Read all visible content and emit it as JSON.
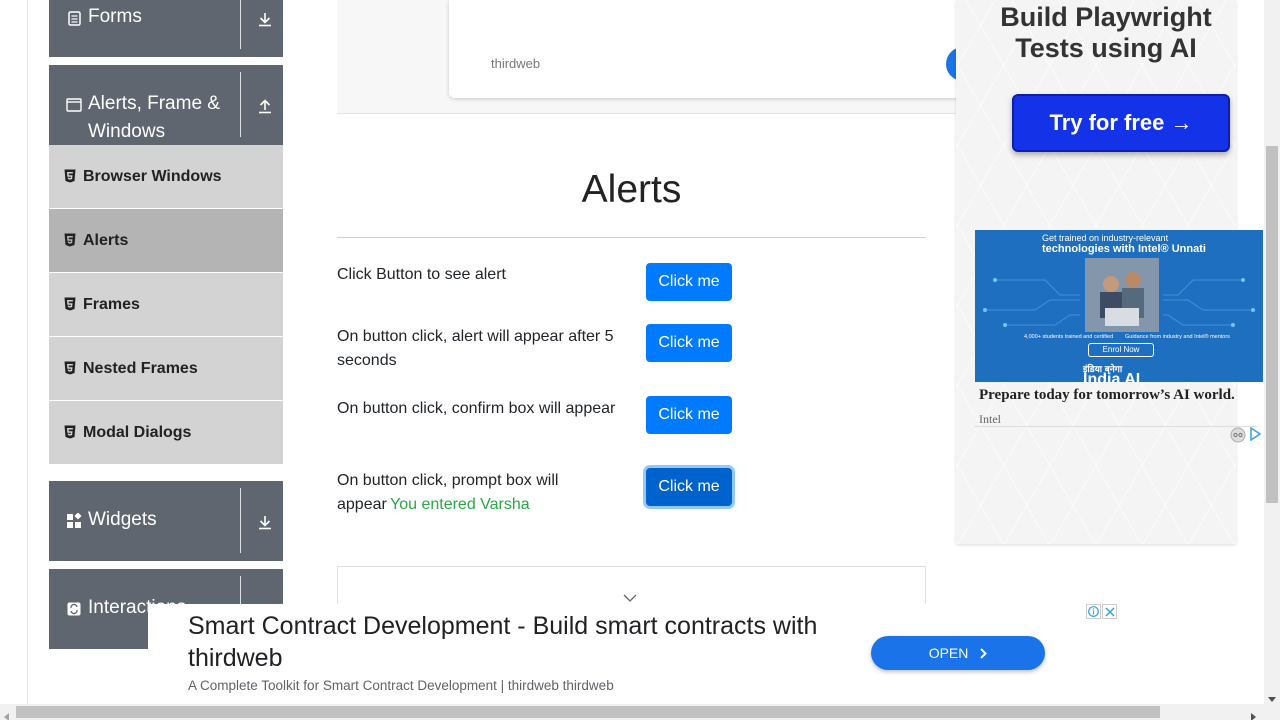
{
  "sidebar": {
    "groups": [
      {
        "label": "Forms",
        "icon": "form-icon",
        "arrow": "download-arrow-icon"
      },
      {
        "label": "Alerts, Frame &",
        "label2": "Windows",
        "icon": "window-icon",
        "arrow": "upload-arrow-icon"
      },
      {
        "label": "Widgets",
        "icon": "widgets-icon",
        "arrow": "download-arrow-icon"
      },
      {
        "label": "Interactions",
        "icon": "interactions-icon"
      }
    ],
    "items": [
      {
        "label": "Browser Windows"
      },
      {
        "label": "Alerts",
        "active": true
      },
      {
        "label": "Frames"
      },
      {
        "label": "Nested Frames"
      },
      {
        "label": "Modal Dialogs"
      }
    ]
  },
  "top_ad": {
    "brand": "thirdweb"
  },
  "main": {
    "title": "Alerts",
    "rows": [
      {
        "text": "Click Button to see alert",
        "button": "Click me"
      },
      {
        "text": "On button click, alert will appear after 5 seconds",
        "button": "Click me"
      },
      {
        "text": "On button click, confirm box will appear",
        "button": "Click me"
      },
      {
        "text": "On button click, prompt box will appear",
        "result": "You entered Varsha",
        "button": "Click me"
      }
    ]
  },
  "right_ad": {
    "headline_line1": "Build Playwright",
    "headline_line2": "Tests using AI",
    "cta": "Try for free →"
  },
  "intel_ad": {
    "line1": "Get trained on industry-relevant",
    "line2": "technologies with Intel® Unnati",
    "small_left": "4,000+ students trained and certified",
    "small_right": "Guidance from industry and Intel® mentors",
    "enrol": "Enrol Now",
    "india_hindi": "इंडिया बनेगा",
    "india_ai": "India AI",
    "caption": "Prepare today for tomorrow’s AI world.",
    "brand": "Intel"
  },
  "bottom_ad": {
    "headline": "Smart Contract Development - Build smart contracts with thirdweb",
    "sub": "A Complete Toolkit for Smart Contract Development | thirdweb thirdweb",
    "open": "OPEN"
  },
  "colors": {
    "primary": "#007bff",
    "sidebar_header": "#5f666f",
    "menu_bg": "#d3d3d3",
    "menu_active": "#b4b4b4",
    "success": "#28a745"
  }
}
